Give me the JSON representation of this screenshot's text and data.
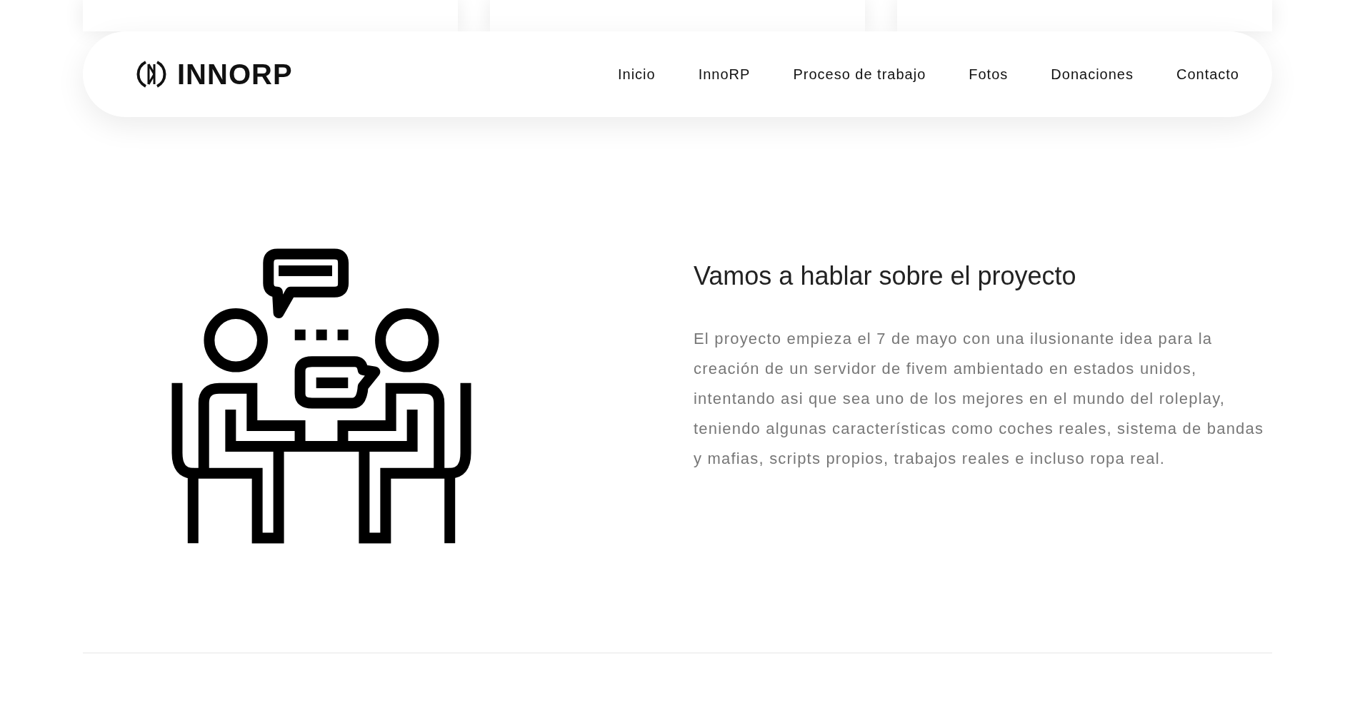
{
  "navbar": {
    "logo_text": "INNORP",
    "links": [
      {
        "label": "Inicio"
      },
      {
        "label": "InnoRP"
      },
      {
        "label": "Proceso de trabajo"
      },
      {
        "label": "Fotos"
      },
      {
        "label": "Donaciones"
      },
      {
        "label": "Contacto"
      }
    ]
  },
  "about": {
    "heading": "Vamos a hablar sobre el proyecto",
    "paragraph": "El proyecto empieza el 7 de mayo con una ilusionante idea para la creación de un servidor de fivem ambientado en estados unidos, intentando asi que sea uno de los mejores en el mundo del roleplay, teniendo algunas características como coches reales, sistema de bandas y mafias, scripts propios, trabajos reales e incluso ropa real."
  }
}
